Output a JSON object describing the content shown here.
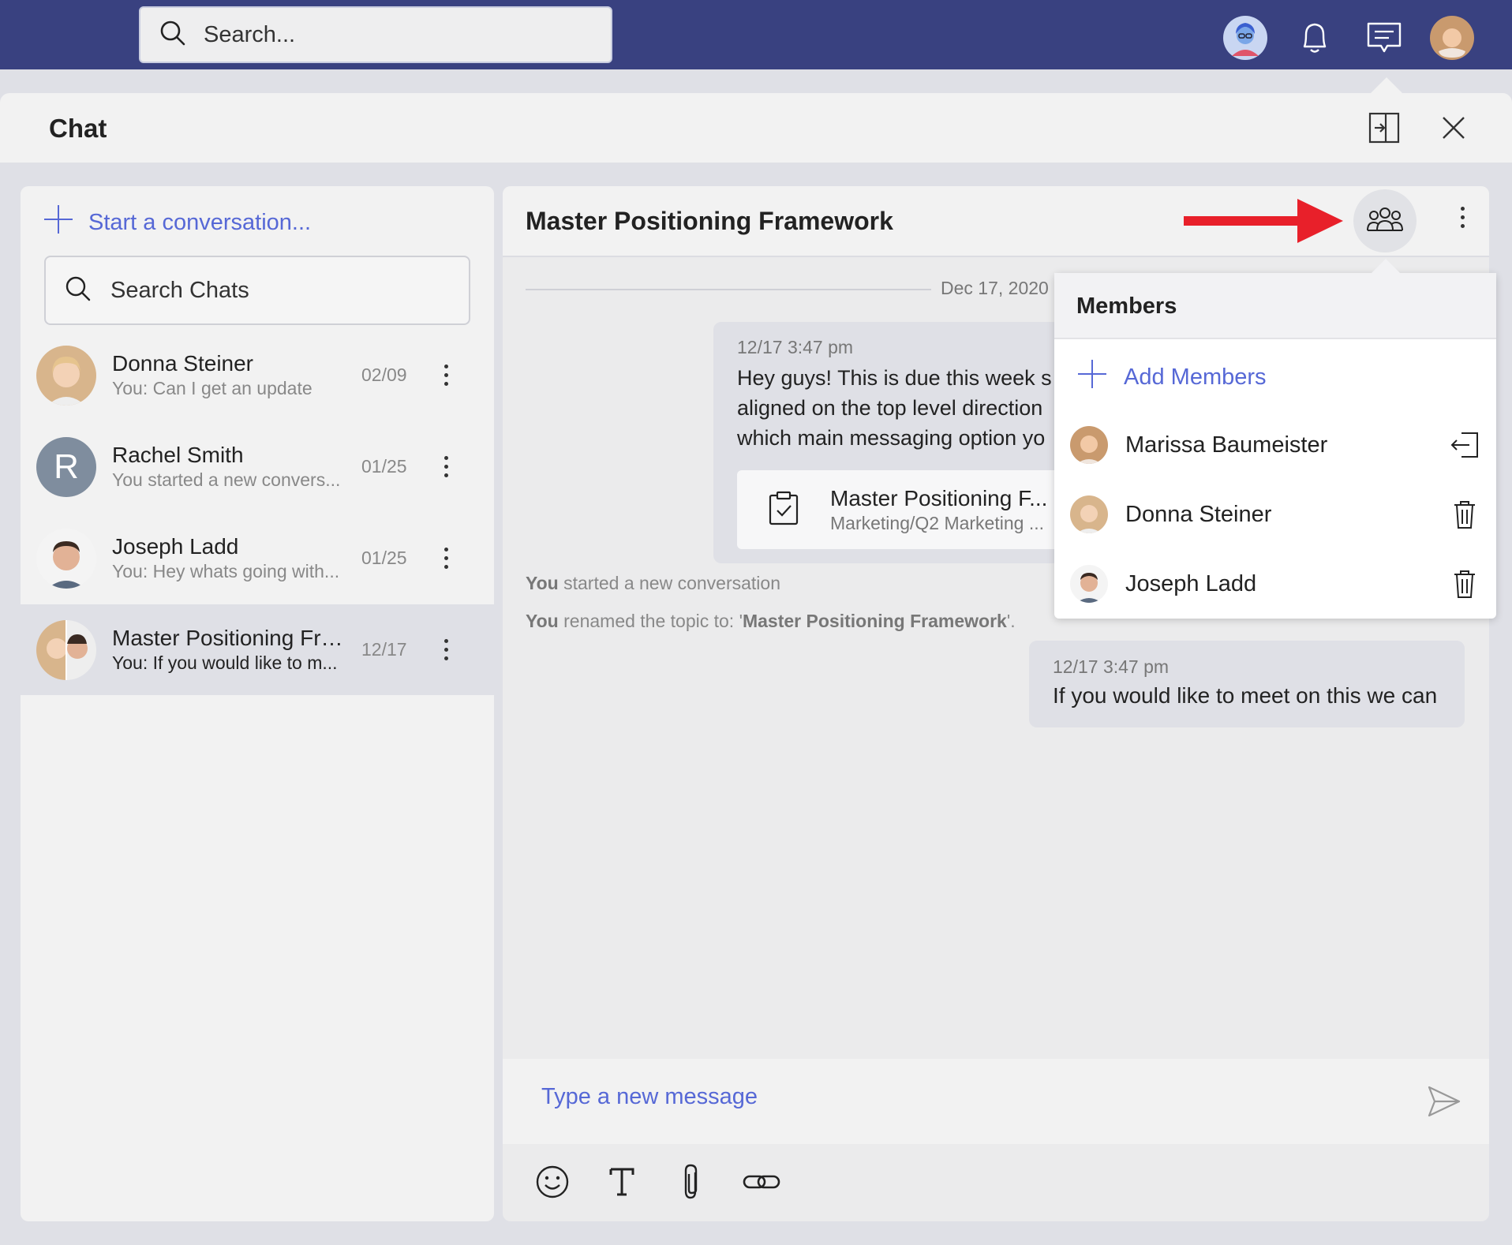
{
  "topbar": {
    "search_placeholder": "Search...",
    "icons": [
      "search-icon",
      "assistant-avatar-icon",
      "bell-icon",
      "chat-icon",
      "user-avatar"
    ]
  },
  "panel": {
    "title": "Chat"
  },
  "sidebar": {
    "start_conversation": "Start a conversation...",
    "search_placeholder": "Search Chats",
    "chats": [
      {
        "name": "Donna Steiner",
        "preview": "You: Can I get an update",
        "date": "02/09"
      },
      {
        "name": "Rachel Smith",
        "preview": "You started a new convers...",
        "date": "01/25",
        "initial": "R"
      },
      {
        "name": "Joseph Ladd",
        "preview": "You: Hey whats going with...",
        "date": "01/25"
      },
      {
        "name": "Master Positioning Fra...",
        "preview": "You: If you would like to m...",
        "date": "12/17"
      }
    ]
  },
  "conversation": {
    "title": "Master Positioning Framework",
    "date_divider": "Dec 17, 2020",
    "message1": {
      "time": "12/17 3:47 pm",
      "lines": [
        "Hey guys! This is due this week s",
        "aligned on the top level direction",
        "which main messaging option yo"
      ],
      "attachment_name": "Master Positioning F...",
      "attachment_path": "Marketing/Q2 Marketing ..."
    },
    "system1": {
      "actor": "You",
      "text": " started a new conversation"
    },
    "system2": {
      "actor": "You",
      "text": " renamed the topic to: '",
      "topic": "Master Positioning Framework",
      "end": "'."
    },
    "message2": {
      "time": "12/17 3:47 pm",
      "text": "If you would like to meet on this we can"
    },
    "composer_placeholder": "Type a new message"
  },
  "members_popover": {
    "title": "Members",
    "add_label": "Add Members",
    "members": [
      {
        "name": "Marissa Baumeister",
        "action": "leave-icon"
      },
      {
        "name": "Donna Steiner",
        "action": "trash-icon"
      },
      {
        "name": "Joseph Ladd",
        "action": "trash-icon"
      }
    ]
  },
  "colors": {
    "topbar": "#394180",
    "accent": "#5668d6",
    "arrow": "#e8202a"
  }
}
